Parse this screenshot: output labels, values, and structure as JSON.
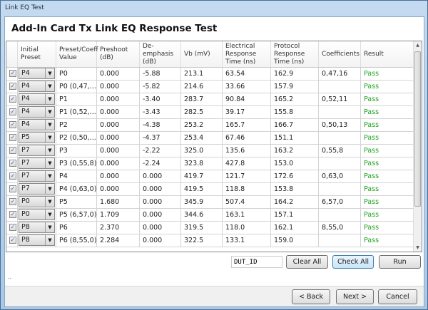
{
  "window_title": "Link EQ Test",
  "heading": "Add-In Card Tx Link EQ Response Test",
  "columns": [
    "",
    "Initial Preset",
    "Preset/Coeff Value",
    "Preshoot (dB)",
    "De-emphasis (dB)",
    "Vb (mV)",
    "Electrical Response Time (ns)",
    "Protocol Response Time (ns)",
    "Coefficients",
    "Result"
  ],
  "rows": [
    [
      "P4",
      "P0",
      "0.000",
      "-5.88",
      "213.1",
      "63.54",
      "162.9",
      "0,47,16",
      "Pass"
    ],
    [
      "P4",
      "P0 (0,47,...",
      "0.000",
      "-5.82",
      "214.6",
      "33.66",
      "157.9",
      "",
      "Pass"
    ],
    [
      "P4",
      "P1",
      "0.000",
      "-3.40",
      "283.7",
      "90.84",
      "165.2",
      "0,52,11",
      "Pass"
    ],
    [
      "P4",
      "P1 (0,52,...",
      "0.000",
      "-3.43",
      "282.5",
      "39.17",
      "155.8",
      "",
      "Pass"
    ],
    [
      "P4",
      "P2",
      "0.000",
      "-4.38",
      "253.2",
      "165.7",
      "166.7",
      "0,50,13",
      "Pass"
    ],
    [
      "P5",
      "P2 (0,50,...",
      "0.000",
      "-4.37",
      "253.4",
      "67.46",
      "151.1",
      "",
      "Pass"
    ],
    [
      "P7",
      "P3",
      "0.000",
      "-2.22",
      "325.0",
      "135.6",
      "163.2",
      "0,55,8",
      "Pass"
    ],
    [
      "P7",
      "P3 (0,55,8)",
      "0.000",
      "-2.24",
      "323.8",
      "427.8",
      "153.0",
      "",
      "Pass"
    ],
    [
      "P7",
      "P4",
      "0.000",
      "0.000",
      "419.7",
      "121.7",
      "172.6",
      "0,63,0",
      "Pass"
    ],
    [
      "P7",
      "P4 (0,63,0)",
      "0.000",
      "0.000",
      "419.5",
      "118.8",
      "153.8",
      "",
      "Pass"
    ],
    [
      "P0",
      "P5",
      "1.680",
      "0.000",
      "345.9",
      "507.4",
      "164.2",
      "6,57,0",
      "Pass"
    ],
    [
      "P0",
      "P5 (6,57,0)",
      "1.709",
      "0.000",
      "344.6",
      "163.1",
      "157.1",
      "",
      "Pass"
    ],
    [
      "P8",
      "P6",
      "2.370",
      "0.000",
      "319.5",
      "118.0",
      "162.1",
      "8,55,0",
      "Pass"
    ],
    [
      "P8",
      "P6 (8,55,0)",
      "2.284",
      "0.000",
      "322.5",
      "133.1",
      "159.0",
      "",
      "Pass"
    ]
  ],
  "dut_id": "DUT_ID",
  "clear_all": "Clear All",
  "check_all": "Check All",
  "run": "Run",
  "status": "..",
  "back": "< Back",
  "next": "Next >",
  "cancel": "Cancel",
  "colors": {
    "pass": "#22a022"
  }
}
